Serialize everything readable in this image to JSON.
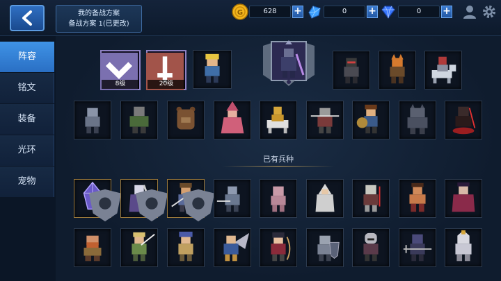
{
  "header": {
    "plan_title": "我的备战方案",
    "plan_subtitle": "备战方案 1(已更改)"
  },
  "resources": [
    {
      "name": "gold",
      "icon": "gold-coin-icon",
      "value": "628",
      "color": "#f2b51c"
    },
    {
      "name": "crystal",
      "icon": "blue-crystal-icon",
      "value": "0",
      "color": "#3da0ff"
    },
    {
      "name": "diamond",
      "icon": "diamond-icon",
      "value": "0",
      "color": "#3a78ff"
    }
  ],
  "sidebar": {
    "items": [
      {
        "label": "阵容",
        "active": true
      },
      {
        "label": "铭文",
        "active": false
      },
      {
        "label": "装备",
        "active": false
      },
      {
        "label": "光环",
        "active": false
      },
      {
        "label": "宠物",
        "active": false
      }
    ]
  },
  "formation": {
    "slot1_level": "8级",
    "slot2_level": "20级"
  },
  "owned_section": {
    "title": "已有兵种"
  },
  "colors": {
    "accent": "#3f93e6",
    "gold_line": "#c9a45a"
  }
}
